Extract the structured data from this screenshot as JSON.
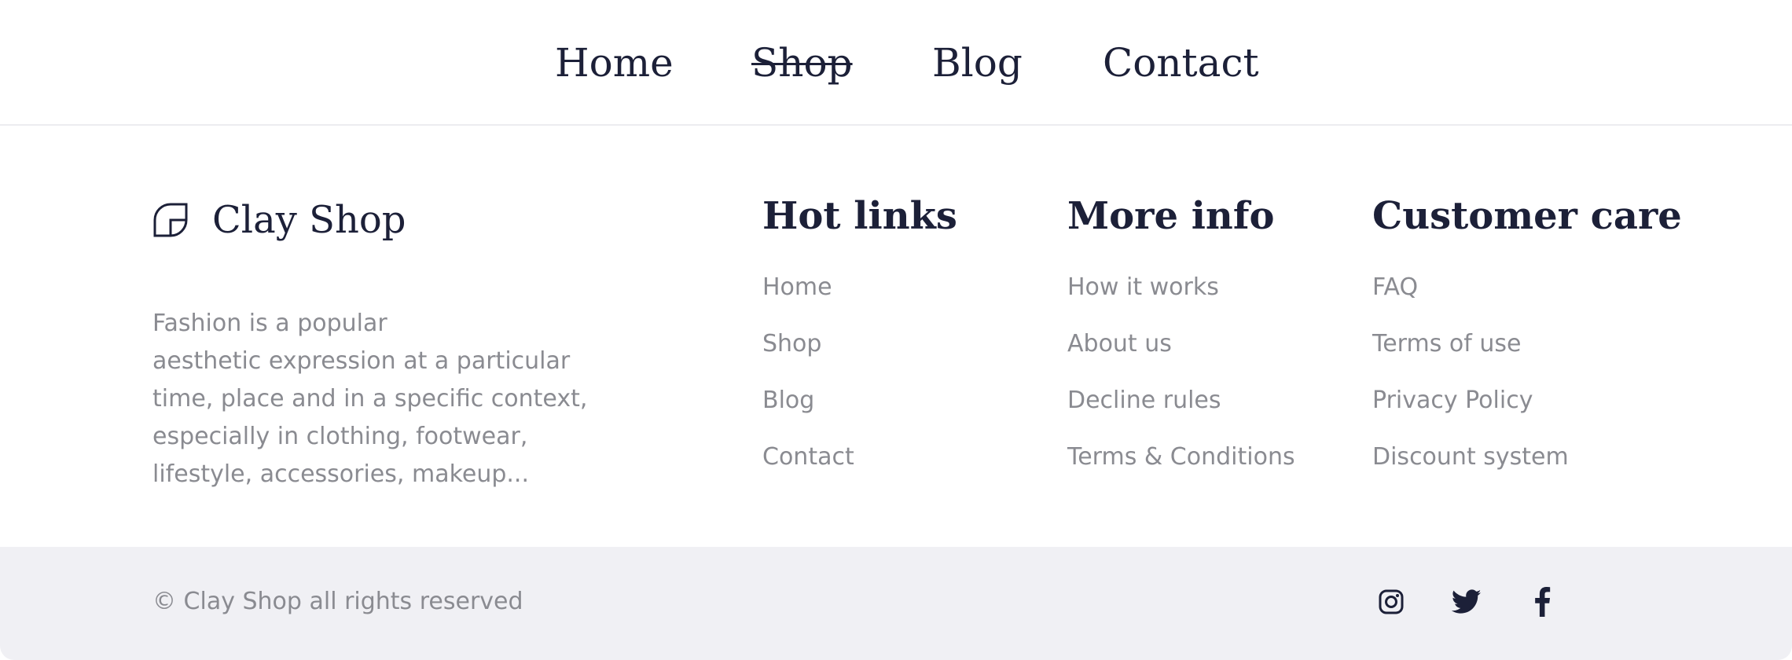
{
  "colors": {
    "heading": "#1c2038",
    "muted": "#8a8b91",
    "bottom_bar": "#f0f0f4",
    "divider": "#ececf0"
  },
  "nav": {
    "items": [
      {
        "label": "Home",
        "active": false
      },
      {
        "label": "Shop",
        "active": true
      },
      {
        "label": "Blog",
        "active": false
      },
      {
        "label": "Contact",
        "active": false
      }
    ]
  },
  "brand": {
    "name": "Clay Shop",
    "logo_icon": "quarter-circle-logo-icon",
    "description": "Fashion is a popular\naesthetic expression at a particular\ntime, place and in a specific context,\nespecially in clothing, footwear,\nlifestyle, accessories, makeup..."
  },
  "columns": [
    {
      "title": "Hot links",
      "links": [
        "Home",
        "Shop",
        "Blog",
        "Contact"
      ]
    },
    {
      "title": "More info",
      "links": [
        "How it works",
        "About us",
        "Decline rules",
        "Terms & Conditions"
      ]
    },
    {
      "title": "Customer care",
      "links": [
        "FAQ",
        "Terms of use",
        "Privacy Policy",
        "Discount system"
      ]
    }
  ],
  "footer": {
    "copyright": "© Clay Shop all rights reserved",
    "social_icons": [
      "instagram-icon",
      "twitter-icon",
      "facebook-icon"
    ]
  }
}
